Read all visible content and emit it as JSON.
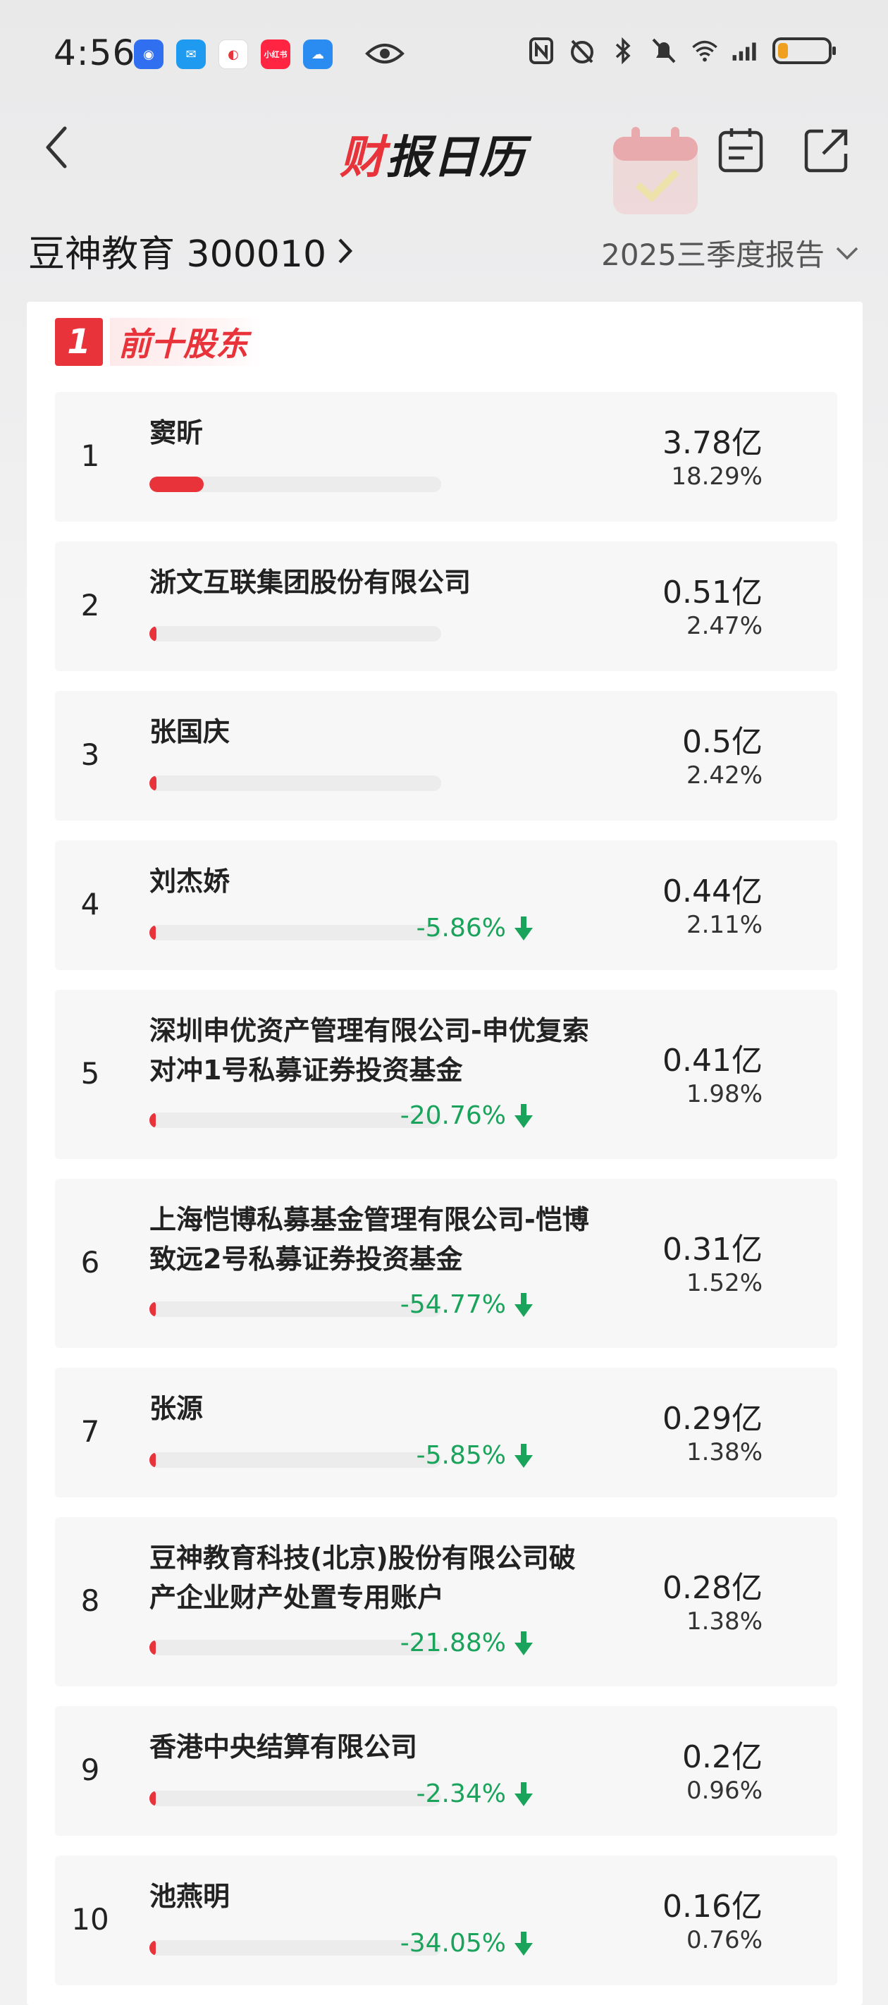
{
  "status_bar": {
    "time": "4:56",
    "battery_level": 0.2,
    "apps": [
      {
        "name": "app-icon-1",
        "color": "#2f6ff0",
        "glyph": "◉"
      },
      {
        "name": "message-app-icon",
        "color": "#1e9bf0",
        "glyph": "✉"
      },
      {
        "name": "app-icon-3",
        "color": "#ffffff",
        "glyph": "◐"
      },
      {
        "name": "xiaohongshu-icon",
        "color": "#ff2442",
        "glyph": "小红书"
      },
      {
        "name": "weather-app-icon",
        "color": "#2a8cf0",
        "glyph": "☁"
      }
    ]
  },
  "header": {
    "brand_part1": "财",
    "brand_part2": "报日历"
  },
  "stock": {
    "title": "豆神教育 300010",
    "report": "2025三季度报告"
  },
  "section": {
    "number": "1",
    "title": "前十股东"
  },
  "colors": {
    "accent_red": "#e8333a",
    "down_green": "#19a35b"
  },
  "shareholders": [
    {
      "rank": "1",
      "name": "窦昕",
      "amount": "3.78亿",
      "pct": "18.29%",
      "ratio": 0.1829,
      "change": ""
    },
    {
      "rank": "2",
      "name": "浙文互联集团股份有限公司",
      "amount": "0.51亿",
      "pct": "2.47%",
      "ratio": 0.0247,
      "change": ""
    },
    {
      "rank": "3",
      "name": "张国庆",
      "amount": "0.5亿",
      "pct": "2.42%",
      "ratio": 0.0242,
      "change": ""
    },
    {
      "rank": "4",
      "name": "刘杰娇",
      "amount": "0.44亿",
      "pct": "2.11%",
      "ratio": 0.0211,
      "change": "-5.86%"
    },
    {
      "rank": "5",
      "name": "深圳申优资产管理有限公司-申优复索对冲1号私募证券投资基金",
      "amount": "0.41亿",
      "pct": "1.98%",
      "ratio": 0.0198,
      "change": "-20.76%"
    },
    {
      "rank": "6",
      "name": "上海恺博私募基金管理有限公司-恺博致远2号私募证券投资基金",
      "amount": "0.31亿",
      "pct": "1.52%",
      "ratio": 0.0152,
      "change": "-54.77%"
    },
    {
      "rank": "7",
      "name": "张源",
      "amount": "0.29亿",
      "pct": "1.38%",
      "ratio": 0.0138,
      "change": "-5.85%"
    },
    {
      "rank": "8",
      "name": "豆神教育科技(北京)股份有限公司破产企业财产处置专用账户",
      "amount": "0.28亿",
      "pct": "1.38%",
      "ratio": 0.0138,
      "change": "-21.88%"
    },
    {
      "rank": "9",
      "name": "香港中央结算有限公司",
      "amount": "0.2亿",
      "pct": "0.96%",
      "ratio": 0.0096,
      "change": "-2.34%"
    },
    {
      "rank": "10",
      "name": "池燕明",
      "amount": "0.16亿",
      "pct": "0.76%",
      "ratio": 0.0076,
      "change": "-34.05%"
    }
  ]
}
